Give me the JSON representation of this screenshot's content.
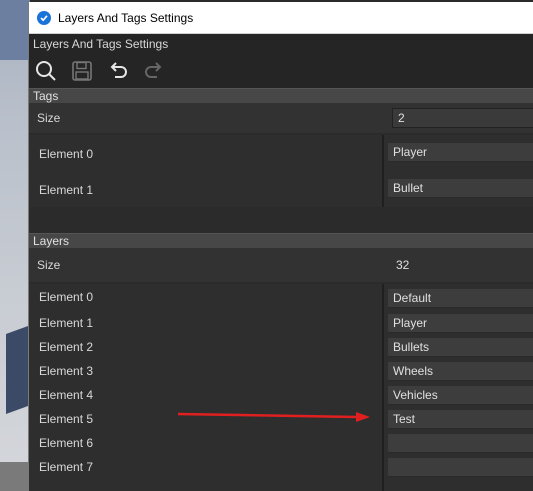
{
  "window": {
    "title": "Layers And Tags Settings"
  },
  "header": {
    "title": "Layers And Tags Settings"
  },
  "toolbar": {
    "buttons": [
      {
        "name": "search-button",
        "icon": "search-icon"
      },
      {
        "name": "save-button",
        "icon": "save-icon"
      },
      {
        "name": "undo-button",
        "icon": "undo-icon"
      },
      {
        "name": "redo-button",
        "icon": "redo-icon"
      }
    ]
  },
  "tags": {
    "title": "Tags",
    "size_label": "Size",
    "size_value": "2",
    "elements": [
      {
        "label": "Element 0",
        "value": "Player"
      },
      {
        "label": "Element 1",
        "value": "Bullet"
      }
    ]
  },
  "layers": {
    "title": "Layers",
    "size_label": "Size",
    "size_value": "32",
    "elements": [
      {
        "label": "Element 0",
        "value": "Default"
      },
      {
        "label": "Element 1",
        "value": "Player"
      },
      {
        "label": "Element 2",
        "value": "Bullets"
      },
      {
        "label": "Element 3",
        "value": "Wheels"
      },
      {
        "label": "Element 4",
        "value": "Vehicles"
      },
      {
        "label": "Element 5",
        "value": "Test"
      },
      {
        "label": "Element 6",
        "value": ""
      },
      {
        "label": "Element 7",
        "value": ""
      }
    ]
  },
  "colors": {
    "accent": "#1a73d9",
    "annotation_arrow": "#e02020",
    "panel": "#2b2b2b"
  }
}
